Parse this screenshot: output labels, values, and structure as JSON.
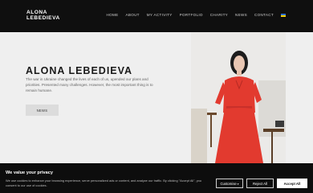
{
  "header": {
    "logo_line1": "ALONA",
    "logo_line2": "LEBEDIEVA",
    "nav": [
      "HOME",
      "ABOUT",
      "MY ACTIVITY",
      "PORTFOLIO",
      "CHARITY",
      "NEWS",
      "CONTACT"
    ]
  },
  "hero": {
    "title": "ALONA LEBEDIEVA",
    "description": "The war in Ukraine changed the lives of each of us, upended our plans and priorities. Presented many challenges. However, the most important thing is to remain humane.",
    "button_label": "NEWS"
  },
  "cookie": {
    "title": "We value your privacy",
    "text": "We use cookies to enhance your browsing experience, serve personalized ads or content, and analyze our traffic. By clicking \"Accept All\", you consent to our use of cookies.",
    "customise_label": "Customise",
    "reject_label": "Reject All",
    "accept_label": "Accept All"
  },
  "colors": {
    "header_bg": "#0f0f0f",
    "hero_bg": "#efefef",
    "dress": "#e23a2f",
    "cookie_bg": "#0d0d0d"
  },
  "icons": [
    "ukraine-flag-icon",
    "chevron-down-icon"
  ]
}
